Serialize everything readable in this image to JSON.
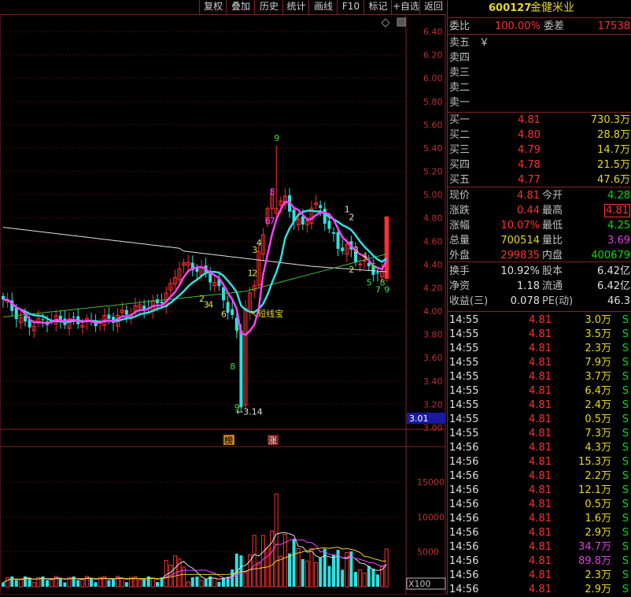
{
  "toolbar": [
    "复权",
    "叠加",
    "历史",
    "统计",
    "画线",
    "F10",
    "标记",
    "+自选",
    "返回"
  ],
  "stock": {
    "code": "600127",
    "name": "金健米业"
  },
  "weibi": {
    "label": "委比",
    "pct": "100.00%",
    "diff_label": "委差",
    "diff": "17538"
  },
  "sell": [
    {
      "label": "卖五",
      "price": "￥",
      "vol": ""
    },
    {
      "label": "卖四",
      "price": "",
      "vol": ""
    },
    {
      "label": "卖三",
      "price": "",
      "vol": ""
    },
    {
      "label": "卖二",
      "price": "",
      "vol": ""
    },
    {
      "label": "卖一",
      "price": "",
      "vol": ""
    }
  ],
  "buy": [
    {
      "label": "买一",
      "price": "4.81",
      "vol": "730.3万"
    },
    {
      "label": "买二",
      "price": "4.80",
      "vol": "28.8万"
    },
    {
      "label": "买三",
      "price": "4.79",
      "vol": "14.7万"
    },
    {
      "label": "买四",
      "price": "4.78",
      "vol": "21.5万"
    },
    {
      "label": "买五",
      "price": "4.77",
      "vol": "47.6万"
    }
  ],
  "quote": [
    {
      "l1": "现价",
      "v1": "4.81",
      "c1": "red",
      "l2": "今开",
      "v2": "4.28",
      "c2": "green"
    },
    {
      "l1": "涨跌",
      "v1": "0.44",
      "c1": "red",
      "l2": "最高",
      "v2": "4.81",
      "c2": "red"
    },
    {
      "l1": "涨幅",
      "v1": "10.07%",
      "c1": "red",
      "l2": "最低",
      "v2": "4.25",
      "c2": "green"
    },
    {
      "l1": "总量",
      "v1": "700514",
      "c1": "yel",
      "l2": "量比",
      "v2": "3.69",
      "c2": "mag"
    },
    {
      "l1": "外盘",
      "v1": "299835",
      "c1": "red",
      "l2": "内盘",
      "v2": "400679",
      "c2": "green"
    }
  ],
  "fund": [
    {
      "l1": "换手",
      "v1": "10.92%",
      "l2": "股本",
      "v2": "6.42亿"
    },
    {
      "l1": "净资",
      "v1": "1.18",
      "l2": "流通",
      "v2": "6.42亿"
    },
    {
      "l1": "收益(三)",
      "v1": "0.078",
      "l2": "PE(动)",
      "v2": "46.3"
    }
  ],
  "trades": [
    {
      "t": "14:55",
      "p": "4.81",
      "v": "3.0万",
      "s": "S",
      "vc": "yel"
    },
    {
      "t": "14:55",
      "p": "4.81",
      "v": "3.5万",
      "s": "S",
      "vc": "yel"
    },
    {
      "t": "14:55",
      "p": "4.81",
      "v": "2.3万",
      "s": "S",
      "vc": "yel"
    },
    {
      "t": "14:55",
      "p": "4.81",
      "v": "7.9万",
      "s": "S",
      "vc": "yel"
    },
    {
      "t": "14:55",
      "p": "4.81",
      "v": "3.7万",
      "s": "S",
      "vc": "yel"
    },
    {
      "t": "14:55",
      "p": "4.81",
      "v": "6.4万",
      "s": "S",
      "vc": "yel"
    },
    {
      "t": "14:55",
      "p": "4.81",
      "v": "2.4万",
      "s": "S",
      "vc": "yel"
    },
    {
      "t": "14:55",
      "p": "4.81",
      "v": "0.5万",
      "s": "S",
      "vc": "yel"
    },
    {
      "t": "14:55",
      "p": "4.81",
      "v": "7.3万",
      "s": "S",
      "vc": "yel"
    },
    {
      "t": "14:56",
      "p": "4.81",
      "v": "4.3万",
      "s": "S",
      "vc": "yel"
    },
    {
      "t": "14:56",
      "p": "4.81",
      "v": "15.3万",
      "s": "S",
      "vc": "yel"
    },
    {
      "t": "14:56",
      "p": "4.81",
      "v": "2.2万",
      "s": "S",
      "vc": "yel"
    },
    {
      "t": "14:56",
      "p": "4.81",
      "v": "12.1万",
      "s": "S",
      "vc": "yel"
    },
    {
      "t": "14:56",
      "p": "4.81",
      "v": "0.5万",
      "s": "S",
      "vc": "yel"
    },
    {
      "t": "14:56",
      "p": "4.81",
      "v": "1.6万",
      "s": "S",
      "vc": "yel"
    },
    {
      "t": "14:56",
      "p": "4.81",
      "v": "2.9万",
      "s": "S",
      "vc": "yel"
    },
    {
      "t": "14:56",
      "p": "4.81",
      "v": "34.7万",
      "s": "S",
      "vc": "mag"
    },
    {
      "t": "14:56",
      "p": "4.81",
      "v": "89.8万",
      "s": "S",
      "vc": "mag"
    },
    {
      "t": "14:56",
      "p": "4.81",
      "v": "2.3万",
      "s": "S",
      "vc": "yel"
    },
    {
      "t": "14:56",
      "p": "4.81",
      "v": "2.9万",
      "s": "S",
      "vc": "yel"
    }
  ],
  "chart_data": {
    "type": "candlestick",
    "price_axis": [
      "6.40",
      "6.20",
      "6.00",
      "5.80",
      "5.60",
      "5.40",
      "5.20",
      "5.00",
      "4.80",
      "4.60",
      "4.40",
      "4.20",
      "4.00",
      "3.80",
      "3.60",
      "3.40",
      "3.20",
      "3.00"
    ],
    "price_range": [
      3.0,
      6.5
    ],
    "current_price_tag": "3.01",
    "low_marker": "3.14",
    "volume_axis": [
      "15000",
      "10000",
      "5000"
    ],
    "volume_unit": "X100",
    "annotations": [
      "短线宝",
      "榜",
      "涨"
    ],
    "seq_labels": [
      "9",
      "8",
      "6",
      "7",
      "1",
      "2",
      "3",
      "4",
      "5",
      "6",
      "7",
      "8",
      "9",
      "8",
      "7",
      "6",
      "5",
      "4",
      "3",
      "2",
      "1"
    ],
    "colors": {
      "up": "#ff3030",
      "down": "#30e0e0",
      "ma_white": "#e0e0e0",
      "ma_magenta": "#ff40ff",
      "ma_cyan": "#30e0e0",
      "ma_green": "#40c040"
    }
  }
}
